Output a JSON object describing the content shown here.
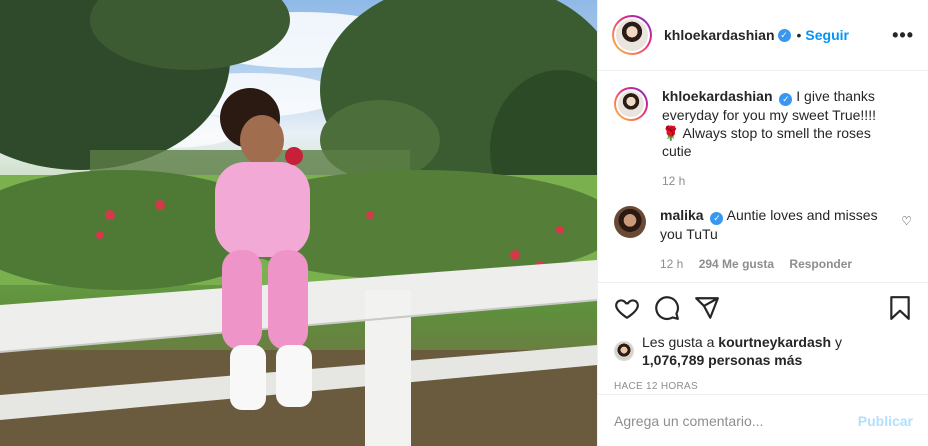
{
  "post": {
    "author": "khloekardashian",
    "follow_label": "Seguir",
    "dot": "•",
    "more_icon": "more-horizontal-icon",
    "verified_icon": "✓"
  },
  "caption": {
    "author": "khloekardashian",
    "text": "I give thanks everyday for you my sweet True!!!! 🌹 Always stop to smell the roses cutie",
    "time": "12 h"
  },
  "reply": {
    "author": "malika",
    "text": "Auntie loves and misses you TuTu",
    "time": "12 h",
    "likes": "294 Me gusta",
    "reply_label": "Responder",
    "heart": "♡"
  },
  "likes": {
    "prefix": "Les gusta a",
    "user": "kourtneykardash",
    "connector": "y",
    "count": "1,076,789 personas más"
  },
  "timestamp": "HACE 12 HORAS",
  "comment_box": {
    "placeholder": "Agrega un comentario...",
    "publish_label": "Publicar"
  },
  "colors": {
    "accent": "#0095f6",
    "verified": "#3897f0",
    "muted": "#8e8e8e",
    "publish_disabled": "#b2dffc"
  }
}
